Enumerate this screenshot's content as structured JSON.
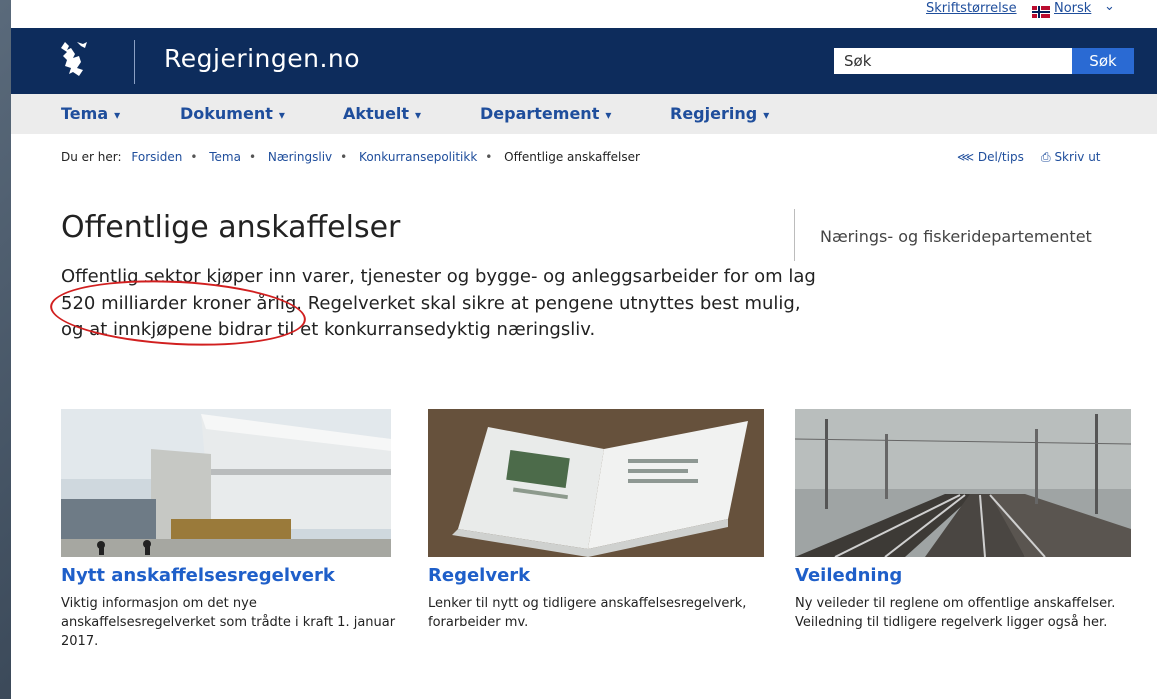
{
  "util": {
    "font_size_label": "Skriftstørrelse",
    "language_label": "Norsk",
    "chevron": "⌄"
  },
  "header": {
    "site_title": "Regjeringen.no",
    "search_placeholder": "Søk",
    "search_button": "Søk"
  },
  "nav": [
    {
      "label": "Tema"
    },
    {
      "label": "Dokument"
    },
    {
      "label": "Aktuelt"
    },
    {
      "label": "Departement"
    },
    {
      "label": "Regjering"
    }
  ],
  "breadcrumb": {
    "prefix": "Du er her:",
    "items": [
      "Forsiden",
      "Tema",
      "Næringsliv",
      "Konkurransepolitikk"
    ],
    "current": "Offentlige anskaffelser"
  },
  "tools": {
    "share": "Del/tips",
    "print": "Skriv ut"
  },
  "page": {
    "title": "Offentlige anskaffelser",
    "department": "Nærings- og fiskeridepartementet",
    "lead": "Offentlig sektor kjøper inn varer, tjenester og bygge- og anleggsarbeider for om lag 520 milliarder kroner årlig. Regelverket skal sikre at pengene utnyttes best mulig, og at innkjøpene bidrar til et konkurransedyktig næringsliv."
  },
  "cards": [
    {
      "title": "Nytt anskaffelsesregelverk",
      "text": "Viktig informasjon om det nye anskaffelsesregelverket som trådte i kraft 1. januar 2017."
    },
    {
      "title": "Regelverk",
      "text": "Lenker til nytt og tidligere anskaffelsesregelverk, forarbeider mv."
    },
    {
      "title": "Veiledning",
      "text": "Ny veileder til reglene om offentlige anskaffelser. Veiledning til tidligere regelverk ligger også her."
    }
  ],
  "colors": {
    "header_bg": "#0d2c5c",
    "link": "#1f4e9c",
    "card_title": "#1f5fc9",
    "annotation_circle": "#d11f1f"
  }
}
